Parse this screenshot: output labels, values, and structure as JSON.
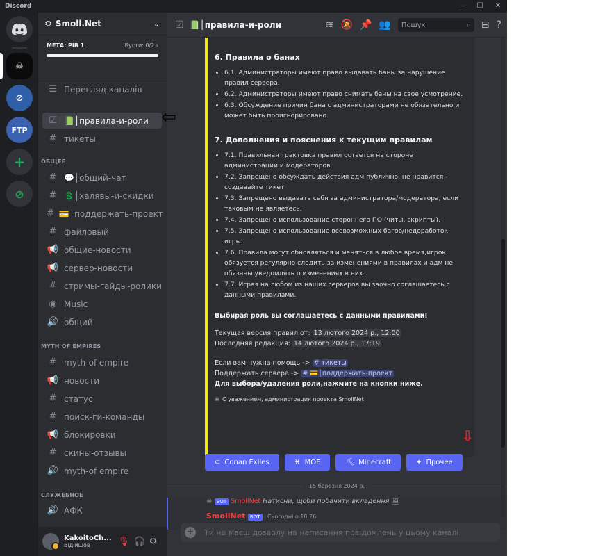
{
  "window": {
    "title": "Discord",
    "minimize": "—",
    "maximize": "☐",
    "close": "✕"
  },
  "server": {
    "name": "Smoll.Net",
    "boost_goal": "МЕТА: РІВ 1",
    "boost_count": "Бусти: 0/2 ›",
    "browse": "Перегляд каналів"
  },
  "channels_top": [
    {
      "name": "📗│правила-и-роли",
      "icon": "☑"
    },
    {
      "name": "тикеты",
      "icon": "#"
    }
  ],
  "categories": {
    "general": "ОБЩЕЕ",
    "moe": "MYTH OF EMPIRES",
    "service": "СЛУЖЕБНОЕ"
  },
  "channels_general": [
    {
      "name": "💬│общий-чат",
      "icon": "#"
    },
    {
      "name": "💲│халявы-и-скидки",
      "icon": "#"
    },
    {
      "name": "💳│поддержать-проект",
      "icon": "#"
    },
    {
      "name": "файловый",
      "icon": "#"
    },
    {
      "name": "общие-новости",
      "icon": "📢"
    },
    {
      "name": "сервер-новости",
      "icon": "📢"
    },
    {
      "name": "стримы-гайды-ролики",
      "icon": "#"
    },
    {
      "name": "Music",
      "icon": "◉"
    },
    {
      "name": "общий",
      "icon": "🔊"
    }
  ],
  "channels_moe": [
    {
      "name": "myth-of-empire",
      "icon": "#"
    },
    {
      "name": "новости",
      "icon": "📢"
    },
    {
      "name": "статус",
      "icon": "#"
    },
    {
      "name": "поиск-ги-команды",
      "icon": "#"
    },
    {
      "name": "блокировки",
      "icon": "📢"
    },
    {
      "name": "скины-отзывы",
      "icon": "#"
    },
    {
      "name": "myth-of empire",
      "icon": "🔊"
    }
  ],
  "channels_service": [
    {
      "name": "АФК",
      "icon": "🔊"
    }
  ],
  "user": {
    "name": "KakoitoCh...",
    "status": "Відійшов"
  },
  "header": {
    "channel": "📗│правила-и-роли",
    "search_placeholder": "Пошук"
  },
  "embed": {
    "s6_title": "6. Правила о банах",
    "s6": [
      "6.1. Администраторы имеют право выдавать баны за нарушение правил сервера.",
      "6.2. Администраторы имеют право снимать баны на свое усмотрение.",
      "6.3. Обсуждение причин бана с администраторами не обязательно и может быть проигнорировано."
    ],
    "s7_title": "7. Дополнения и пояснения к текущим правилам",
    "s7": [
      "7.1. Правильная трактовка правил остается на стороне администрации и модераторов.",
      "7.2. Запрещено обсуждать действия адм публично, не нравится - создавайте тикет",
      "7.3. Запрещено выдавать себя за администратора/модератора, если таковым не являетесь.",
      "7.4. Запрещено использование стороннего ПО (читы, скрипты).",
      "7.5. Запрещено использование всевозможных багов/недоработок игры.",
      "7.6. Правила могут обновляться и меняться в любое время,игрок обязуется регулярно следить за изменениями в правилах и адм не обязаны уведомлять о изменениях в них.",
      "7.7. Играя на любом из наших серверов,вы заочно соглашаетесь с данными правилами."
    ],
    "agree": "Выбирая роль вы соглашаетесь с данными правилами!",
    "version_label": "Текущая версия правил от:",
    "version_date": "13 лютого 2024 р., 12:00",
    "edit_label": "Последняя редакция:",
    "edit_date": "14 лютого 2024 р., 17:19",
    "help_label": "Если вам нужна помощь ->",
    "help_mention": "# тикеты",
    "support_label": "Поддержать сервера ->",
    "support_mention": "# 💳│поддержать-проект",
    "role_hint": "Для выбора/удаления роли,нажмите на кнопки ниже.",
    "footer": "С уважением, администрация проекта SmollNet"
  },
  "buttons": [
    {
      "label": "Conan Exiles",
      "icon": "⊂"
    },
    {
      "label": "MOE",
      "icon": "♓"
    },
    {
      "label": "Minecraft",
      "icon": "⛏"
    },
    {
      "label": "Прочее",
      "icon": "✦"
    }
  ],
  "divider_date": "15 березня 2024 р.",
  "message": {
    "reply_tag": "БОТ",
    "reply_author": "SmollNet",
    "reply_text": "Натисни, щоби побачити вкладення",
    "author": "SmollNet",
    "tag": "БОТ",
    "time": "Сьогодні о 10:26"
  },
  "composer": {
    "placeholder": "Ти не маєш дозволу на написання повідомлень у цьому каналі."
  },
  "colors": {
    "blurple": "#5865f2",
    "embed_bar": "#f0e51a",
    "bot_name": "#f23f43"
  }
}
